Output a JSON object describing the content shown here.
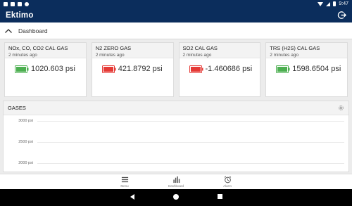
{
  "statusbar": {
    "time": "9:47"
  },
  "app": {
    "title": "Ektimo"
  },
  "section": {
    "title": "Dashboard"
  },
  "cards": [
    {
      "title": "NOx, CO, CO2 CAL GAS",
      "time": "2 minutes ago",
      "value": "1020.603 psi",
      "status": "green"
    },
    {
      "title": "N2 ZERO GAS",
      "time": "2 minutes ago",
      "value": "421.8792 psi",
      "status": "red"
    },
    {
      "title": "SO2 CAL GAS",
      "time": "2 minutes ago",
      "value": "-1.460686 psi",
      "status": "red"
    },
    {
      "title": "TRS (H2S) CAL GAS",
      "time": "2 minutes ago",
      "value": "1598.6504 psi",
      "status": "green"
    }
  ],
  "colors": {
    "green": "#4caf50",
    "red": "#e53935",
    "appbar": "#0b2d5c"
  },
  "gases": {
    "title": "GASES",
    "icon": "gear-icon"
  },
  "chart_data": {
    "type": "line",
    "title": "GASES",
    "ylabel": "",
    "xlabel": "",
    "yticks": [
      "3000 psi",
      "2500 psi",
      "2000 psi"
    ],
    "ytick_values": [
      3000,
      2500,
      2000
    ],
    "series": []
  },
  "bottomnav": [
    {
      "label": "Menu",
      "icon": "menu-icon"
    },
    {
      "label": "Dashboard",
      "icon": "bar-chart-icon"
    },
    {
      "label": "Alarm",
      "icon": "alarm-clock-icon"
    }
  ]
}
